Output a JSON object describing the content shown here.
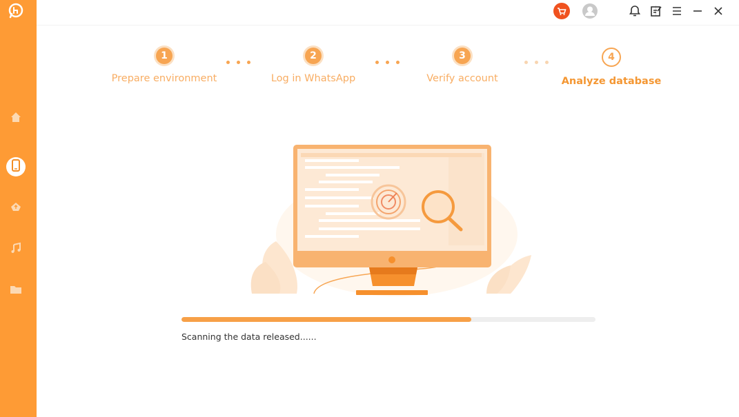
{
  "app": {
    "accent": "#fe9b35",
    "icons": [
      "whatsapp-transfer-logo",
      "home-icon",
      "phone-icon",
      "cloud-upload-icon",
      "music-icon",
      "folder-icon"
    ]
  },
  "topbar": {
    "icons": [
      "cart-icon",
      "user-avatar-icon",
      "bell-icon",
      "feedback-icon",
      "menu-icon",
      "minimize-icon",
      "close-icon"
    ]
  },
  "steps": [
    {
      "number": "1",
      "label": "Prepare environment"
    },
    {
      "number": "2",
      "label": "Log in WhatsApp"
    },
    {
      "number": "3",
      "label": "Verify account"
    },
    {
      "number": "4",
      "label": "Analyze database"
    }
  ],
  "progress": {
    "value": 0.7,
    "status": "Scanning the data released......"
  }
}
